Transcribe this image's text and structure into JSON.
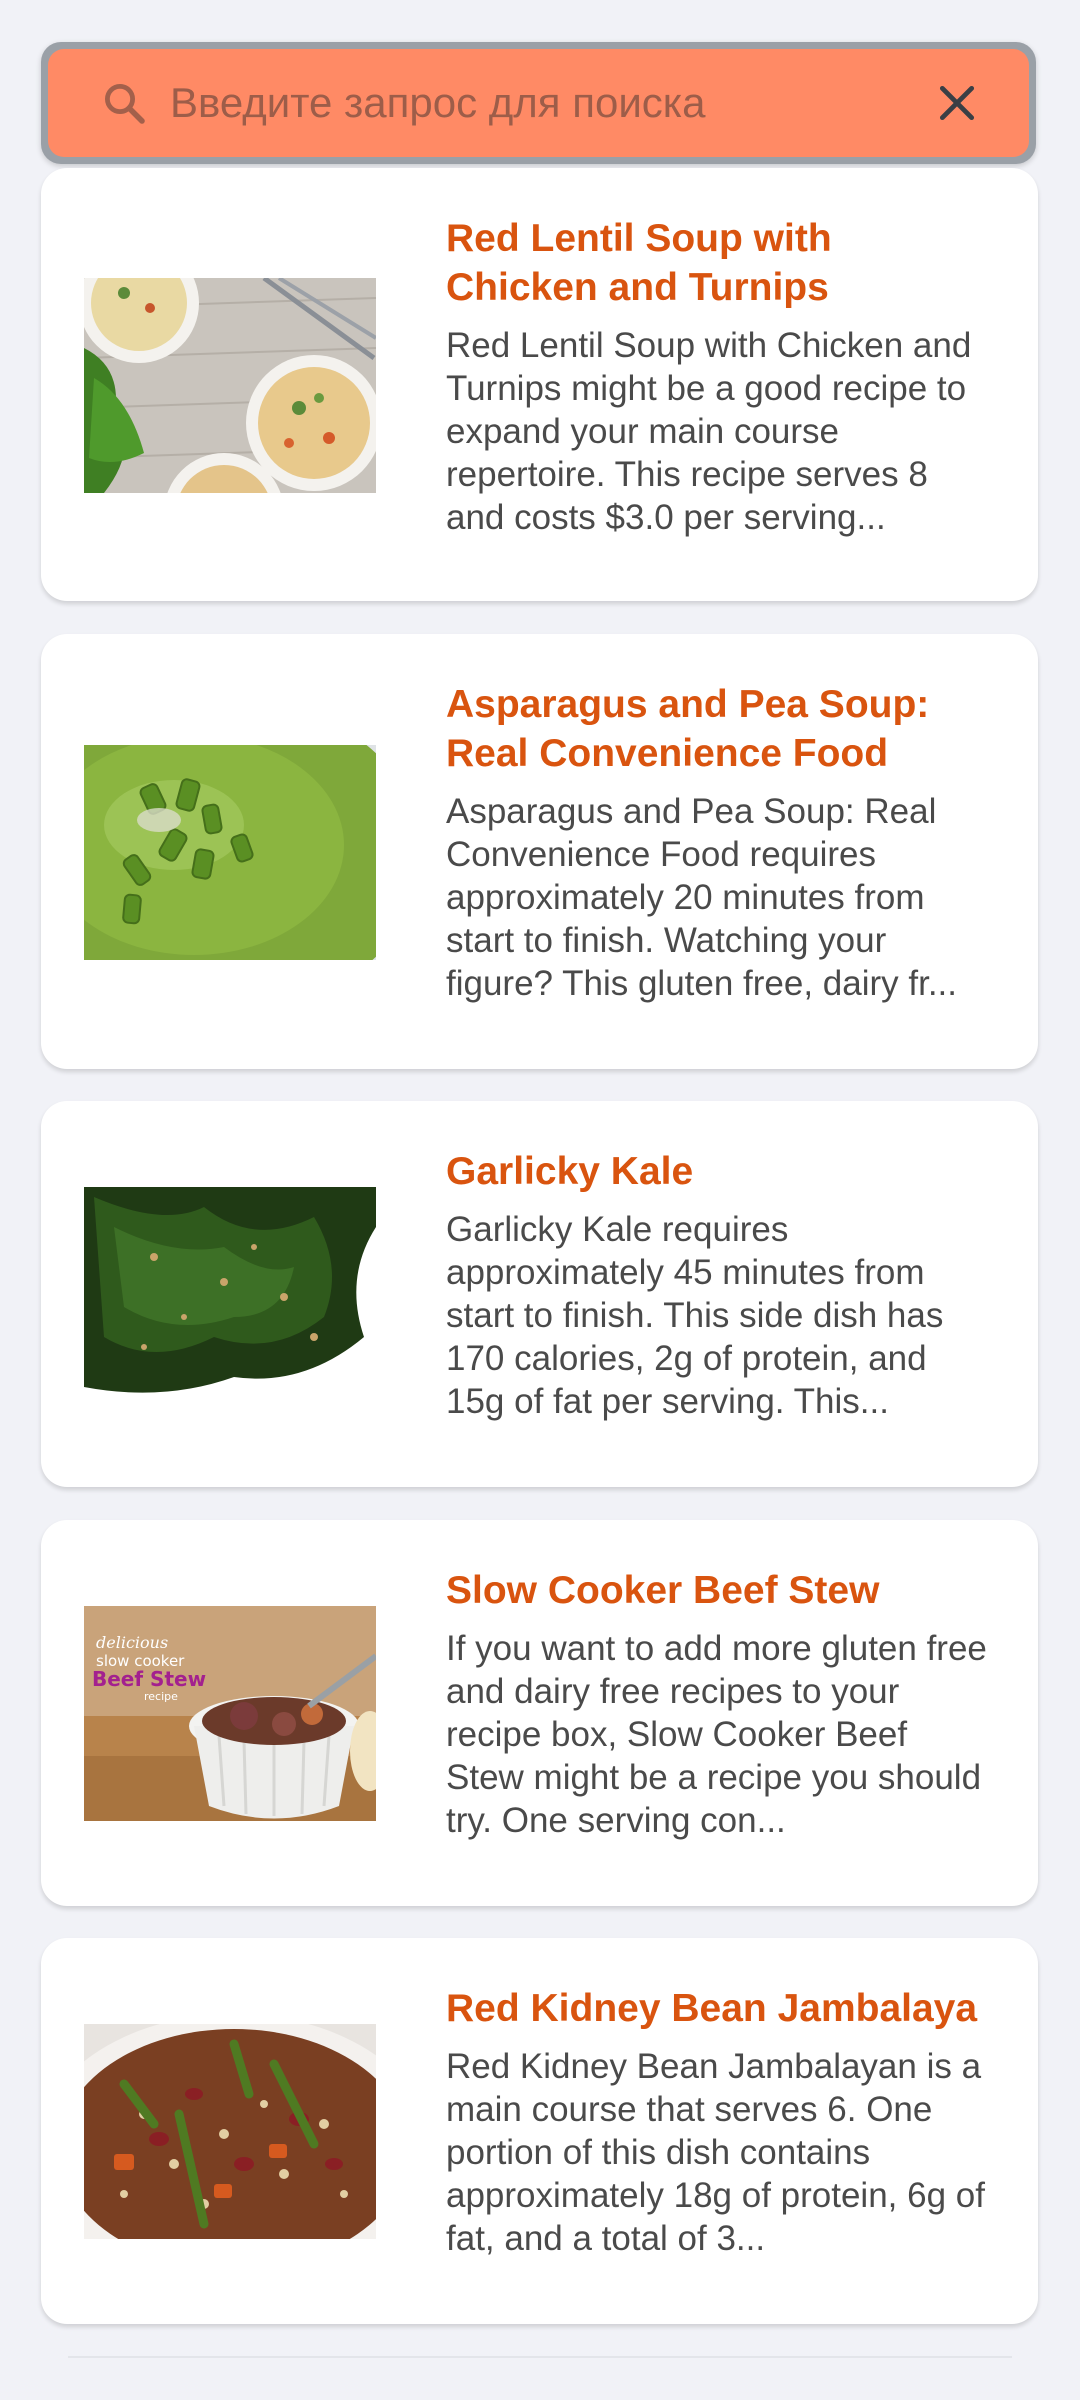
{
  "search": {
    "placeholder": "Введите запрос для поиска",
    "value": "",
    "icon": "search-icon",
    "clear_icon": "close-icon",
    "colors": {
      "field": "#ff8a65",
      "border": "#9aa0a7"
    }
  },
  "theme": {
    "title_color": "#d9540f",
    "text_color": "#4a4a4a",
    "card_bg": "#ffffff",
    "page_bg": "#f1f2f7"
  },
  "recipes": [
    {
      "title": "Red Lentil Soup with Chicken and Turnips",
      "description": "Red Lentil Soup with Chicken and Turnips might be a good recipe to expand your main course repertoire. This recipe serves 8 and costs $3.0 per serving..."
    },
    {
      "title": "Asparagus and Pea Soup: Real Convenience Food",
      "description": "Asparagus and Pea Soup: Real Convenience Food requires approximately 20 minutes from start to finish. Watching your figure? This gluten free, dairy fr..."
    },
    {
      "title": "Garlicky Kale",
      "description": "Garlicky Kale requires approximately 45 minutes from start to finish. This side dish has 170 calories, 2g of protein, and 15g of fat per serving. This..."
    },
    {
      "title": "Slow Cooker Beef Stew",
      "description": "If you want to add more gluten free and dairy free recipes to your recipe box, Slow Cooker Beef Stew might be a recipe you should try. One serving con...",
      "image_text": [
        "delicious",
        "slow cooker",
        "Beef Stew",
        "recipe"
      ]
    },
    {
      "title": "Red Kidney Bean Jambalaya",
      "description": "Red Kidney Bean Jambalayan is a main course that serves 6. One portion of this dish contains approximately 18g of protein, 6g of fat, and a total of 3..."
    }
  ]
}
